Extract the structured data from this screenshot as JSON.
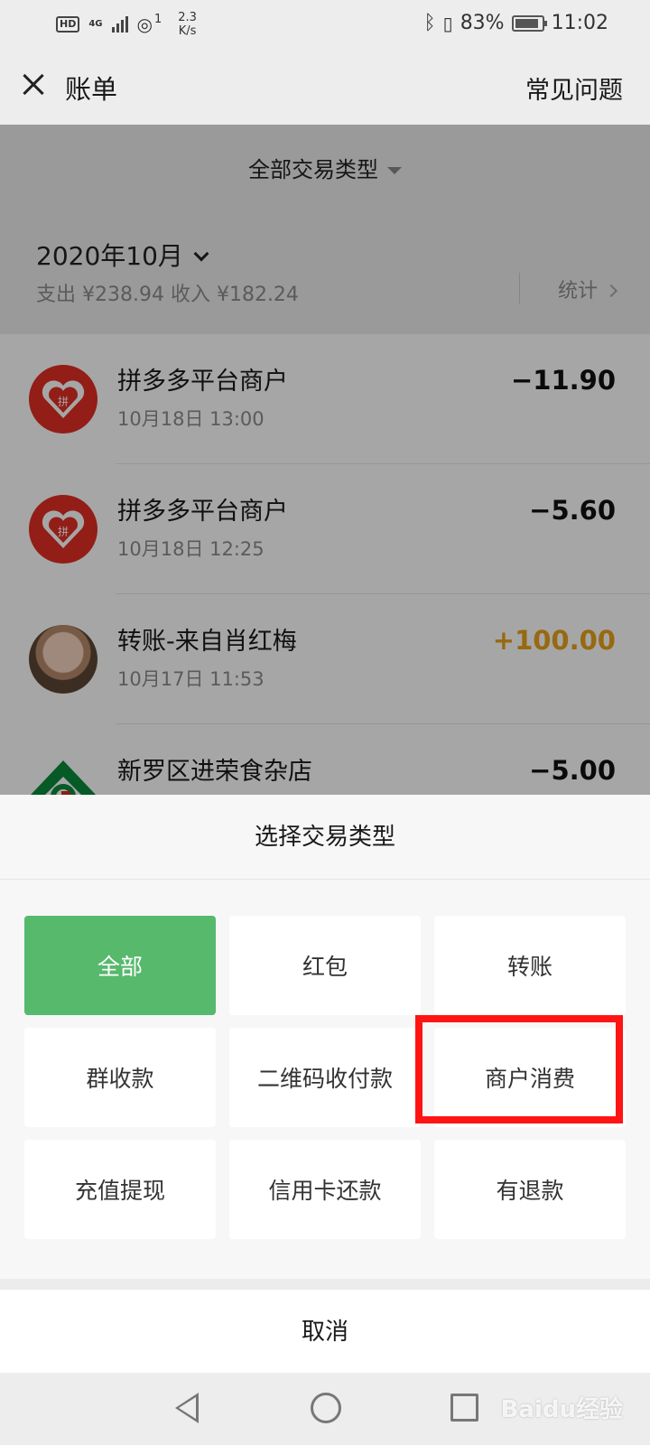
{
  "status_bar": {
    "hd": "HD",
    "network": "4G",
    "sim": "1",
    "speed_value": "2.3",
    "speed_unit": "K/s",
    "battery": "83%",
    "battery_level": 0.83,
    "time": "11:02"
  },
  "header": {
    "title": "账单",
    "faq": "常见问题"
  },
  "filter": {
    "label": "全部交易类型"
  },
  "month_section": {
    "month": "2020年10月",
    "summary": "支出 ¥238.94 收入 ¥182.24",
    "stats": "统计"
  },
  "transactions": [
    {
      "name": "拼多多平台商户",
      "date": "10月18日 13:00",
      "amount": "−11.90",
      "type": "expense",
      "avatar": "pinduoduo-logo"
    },
    {
      "name": "拼多多平台商户",
      "date": "10月18日 12:25",
      "amount": "−5.60",
      "type": "expense",
      "avatar": "pinduoduo-logo"
    },
    {
      "name": "转账-来自肖红梅",
      "date": "10月17日 11:53",
      "amount": "+100.00",
      "type": "income",
      "avatar": "user-photo"
    },
    {
      "name": "新罗区进荣食杂店",
      "date": "",
      "amount": "−5.00",
      "type": "expense",
      "avatar": "bank-logo"
    }
  ],
  "sheet": {
    "title": "选择交易类型",
    "options": [
      "全部",
      "红包",
      "转账",
      "群收款",
      "二维码收付款",
      "商户消费",
      "充值提现",
      "信用卡还款",
      "有退款"
    ],
    "selected": "全部",
    "highlighted": "商户消费",
    "cancel": "取消"
  },
  "colors": {
    "accent_green": "#56b96c",
    "income": "#e9a21a",
    "highlight_red": "#ff1414"
  },
  "watermark": "Baidu经验"
}
